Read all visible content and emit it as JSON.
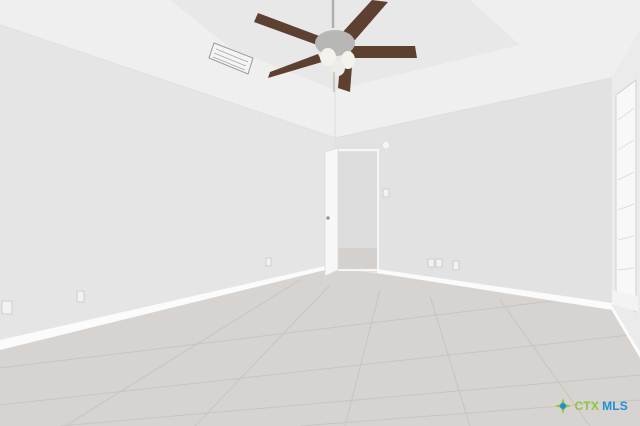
{
  "photo": {
    "subject": "empty-room",
    "colors": {
      "wall_left": "#e6e6e7",
      "wall_back": "#e3e3e4",
      "wall_right": "#eaeaeb",
      "ceiling": "#efeff0",
      "floor": "#d7d4d1",
      "baseboard": "#fafafa",
      "fan_blade": "#5e4030",
      "fan_metal": "#b7b7b5"
    }
  },
  "watermark": {
    "brand_part1": "CTX",
    "brand_part2": "MLS",
    "logo_icon": "ctxmls-logo-icon"
  }
}
